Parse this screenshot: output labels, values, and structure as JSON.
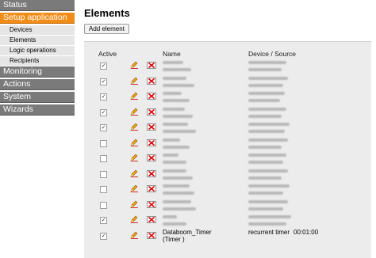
{
  "sidebar": {
    "items": [
      {
        "label": "Status",
        "active": false
      },
      {
        "label": "Setup application",
        "active": true,
        "children": [
          "Devices",
          "Elements",
          "Logic operations",
          "Recipients"
        ]
      },
      {
        "label": "Monitoring",
        "active": false
      },
      {
        "label": "Actions",
        "active": false
      },
      {
        "label": "System",
        "active": false
      },
      {
        "label": "Wizards",
        "active": false
      }
    ]
  },
  "main": {
    "title": "Elements",
    "add_button": "Add element",
    "columns": {
      "active": "Active",
      "name": "Name",
      "device": "Device / Source"
    },
    "rows": [
      {
        "active": true,
        "name": "",
        "source": "",
        "value": ""
      },
      {
        "active": true,
        "name": "",
        "source": "",
        "value": ""
      },
      {
        "active": true,
        "name": "",
        "source": "",
        "value": ""
      },
      {
        "active": true,
        "name": "",
        "source": "",
        "value": ""
      },
      {
        "active": true,
        "name": "",
        "source": "",
        "value": ""
      },
      {
        "active": false,
        "name": "",
        "source": "",
        "value": ""
      },
      {
        "active": false,
        "name": "",
        "source": "",
        "value": ""
      },
      {
        "active": false,
        "name": "",
        "source": "",
        "value": ""
      },
      {
        "active": false,
        "name": "",
        "source": "",
        "value": ""
      },
      {
        "active": false,
        "name": "",
        "source": "",
        "value": ""
      },
      {
        "active": true,
        "name": "",
        "source": "",
        "value": ""
      },
      {
        "active": true,
        "name": "Databoom_Timer\n(Timer )",
        "source": "recurrent timer",
        "value": "00:01:00"
      }
    ]
  },
  "colors": {
    "accent": "#f08c18",
    "nav": "#7a7a7a",
    "panel": "#ececec"
  },
  "icons": {
    "edit": "pencil-icon",
    "delete": "delete-x-icon"
  }
}
